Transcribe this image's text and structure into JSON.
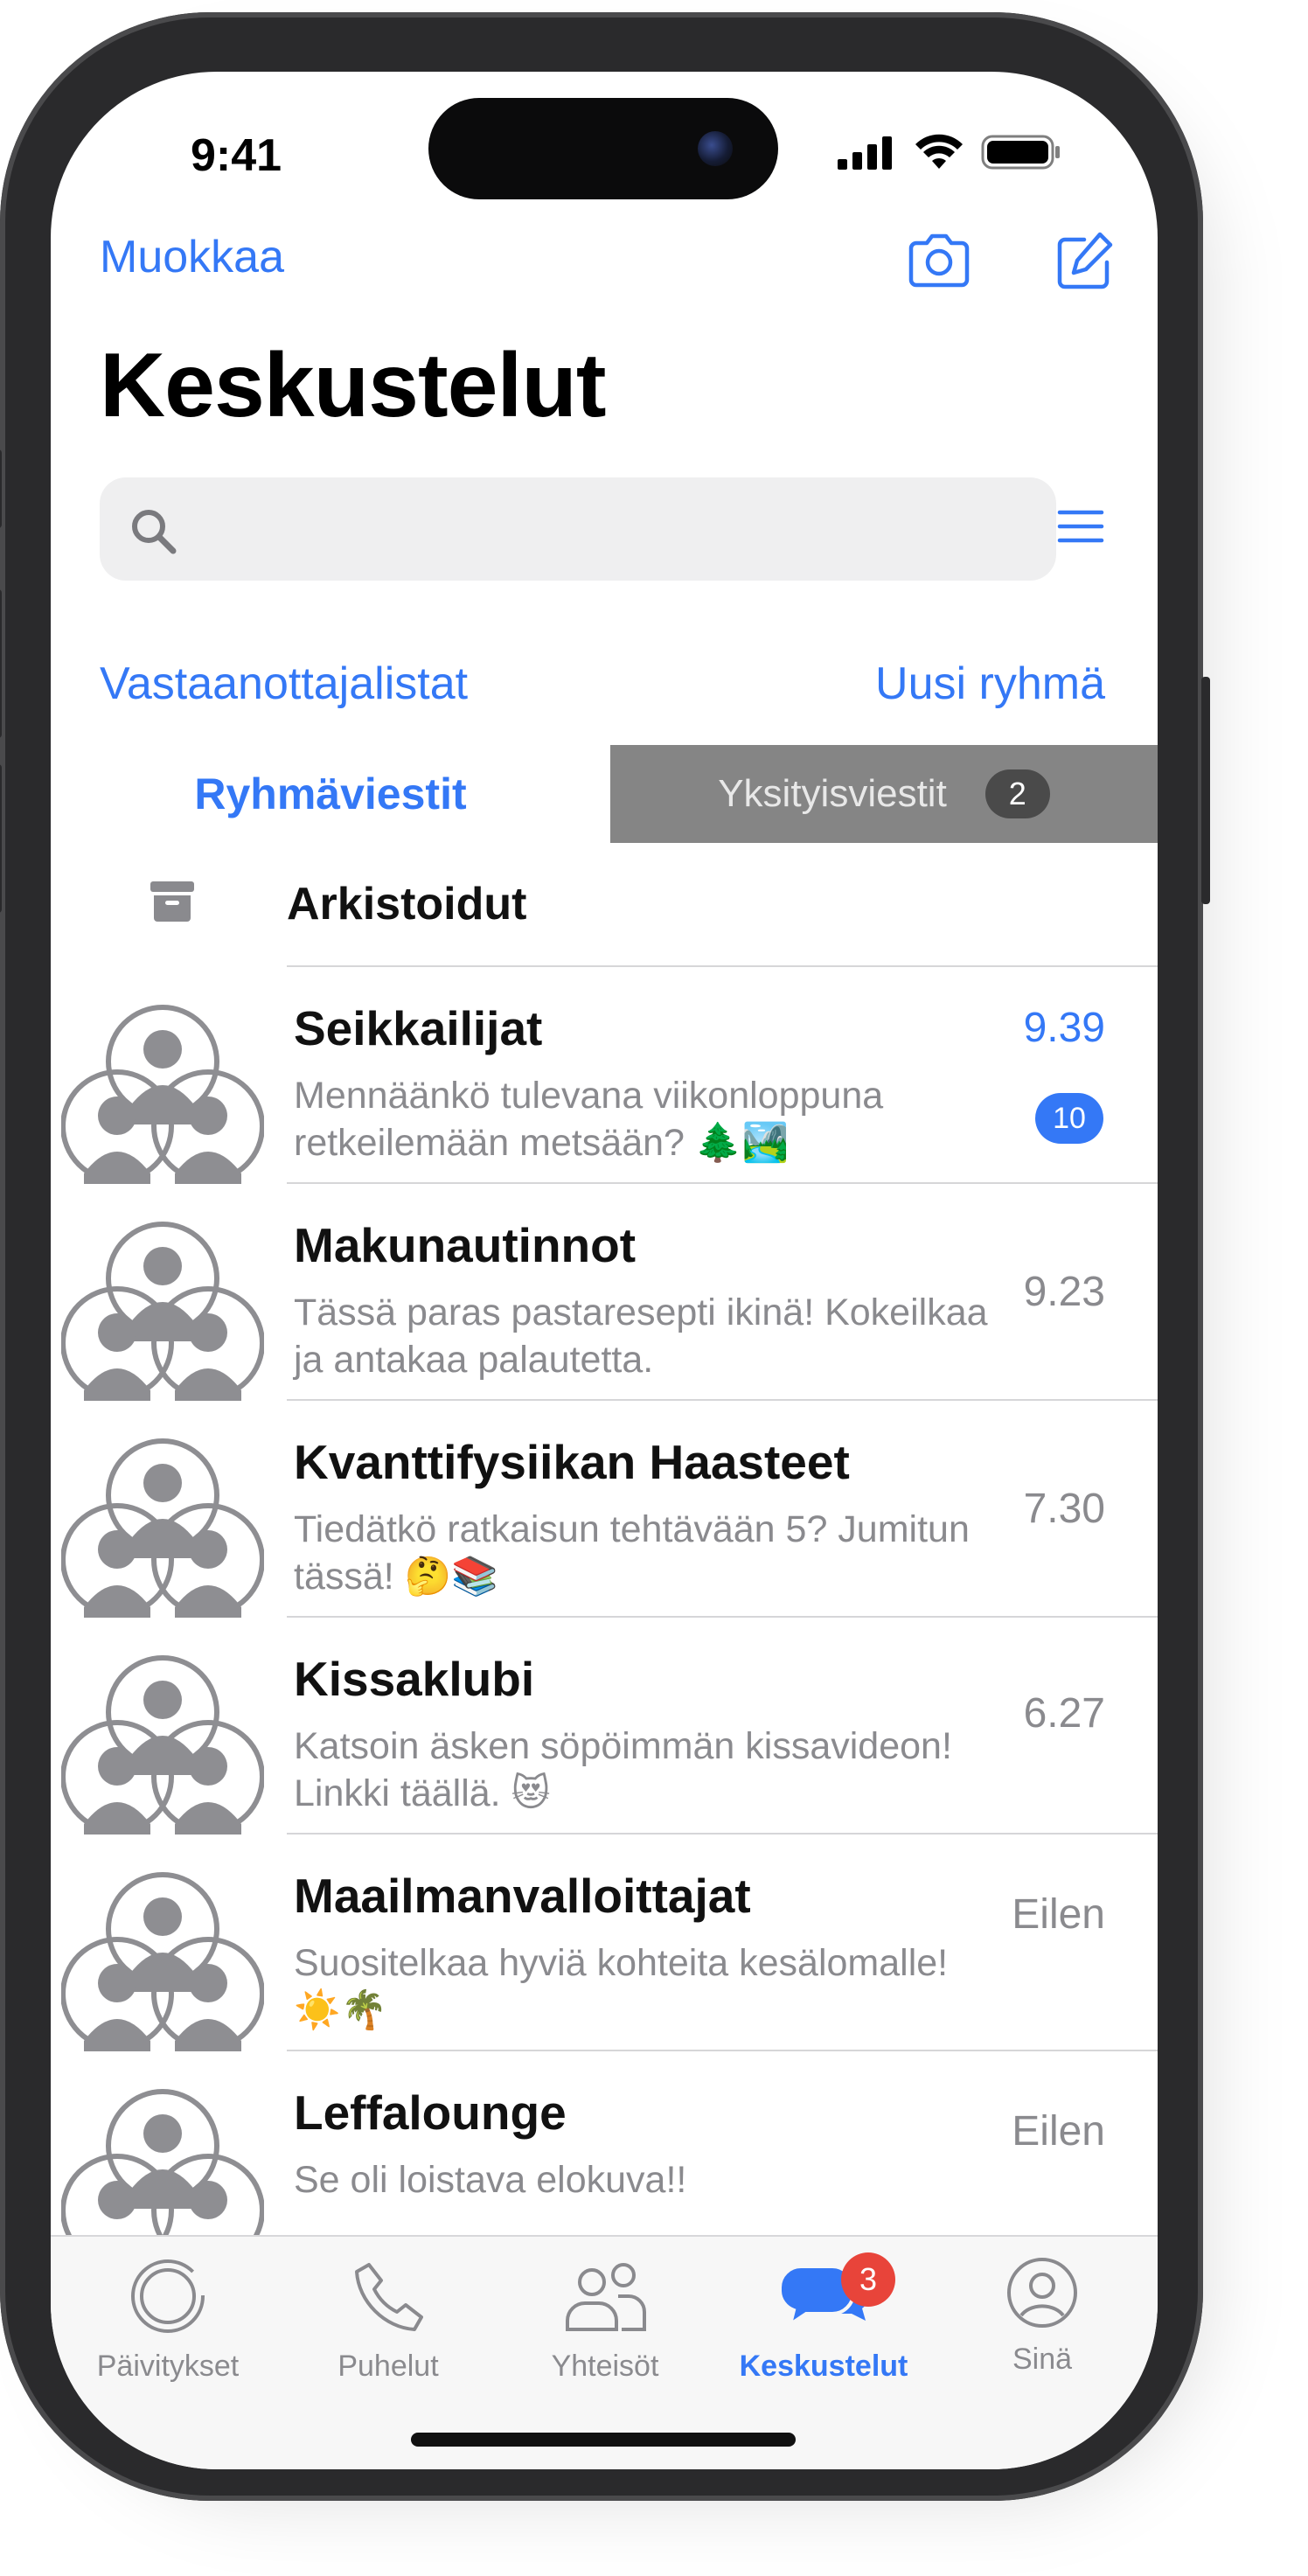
{
  "status_bar": {
    "time": "9:41"
  },
  "header": {
    "edit_label": "Muokkaa",
    "title": "Keskustelut",
    "camera_icon": "camera-icon",
    "compose_icon": "compose-icon"
  },
  "search": {
    "placeholder": "",
    "icon": "search-icon",
    "filter_icon": "menu-icon"
  },
  "links": {
    "broadcast_lists": "Vastaanottajalistat",
    "new_group": "Uusi ryhmä"
  },
  "segment": {
    "groups_label": "Ryhmäviestit",
    "private_label": "Yksityisviestit",
    "private_count": "2"
  },
  "archived": {
    "label": "Arkistoidut",
    "icon": "archive-icon"
  },
  "chats": [
    {
      "name": "Seikkailijat",
      "message": "Mennäänkö tulevana viikonloppuna retkeilemään metsään? 🌲🏞️",
      "time": "9.39",
      "unread": "10"
    },
    {
      "name": "Makunautinnot",
      "message": "Tässä paras pastaresepti ikinä! Kokeilkaa ja antakaa palautetta.",
      "time": "9.23"
    },
    {
      "name": "Kvanttifysiikan Haasteet",
      "message": "Tiedätkö ratkaisun tehtävään 5? Jumitun tässä! 🤔📚",
      "time": "7.30"
    },
    {
      "name": "Kissaklubi",
      "message": "Katsoin äsken söpöimmän kissavideon! Linkki täällä. 😻",
      "time": "6.27"
    },
    {
      "name": "Maailmanvalloittajat",
      "message": "Suositelkaa hyviä kohteita kesälomalle! ☀️🌴",
      "time": "Eilen"
    },
    {
      "name": "Leffalounge",
      "message": "Se oli loistava elokuva!!",
      "time": "Eilen"
    }
  ],
  "tabbar": {
    "items": [
      {
        "label": "Päivitykset",
        "icon": "updates-icon"
      },
      {
        "label": "Puhelut",
        "icon": "phone-icon"
      },
      {
        "label": "Yhteisöt",
        "icon": "communities-icon"
      },
      {
        "label": "Keskustelut",
        "icon": "chats-icon",
        "badge": "3"
      },
      {
        "label": "Sinä",
        "icon": "profile-icon"
      }
    ]
  },
  "colors": {
    "accent": "#3478f6",
    "badge_red": "#e8443a",
    "secondary_text": "#8a8a8e"
  }
}
